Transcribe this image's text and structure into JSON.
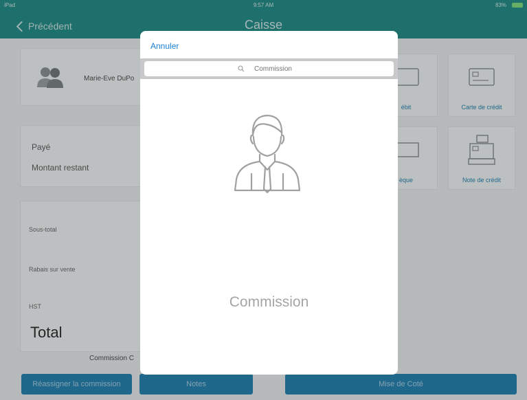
{
  "status_bar": {
    "carrier": "iPad",
    "time": "9:57 AM",
    "battery": "83%"
  },
  "nav": {
    "back_label": "Précédent",
    "title": "Caisse"
  },
  "client": {
    "name": "Marie-Eve DuPo"
  },
  "payment": {
    "paid_label": "Payé",
    "remaining_label": "Montant restant"
  },
  "totals": {
    "subtotal_label": "Sous-total",
    "discount_label": "Rabais sur vente",
    "tax_label": "HST",
    "total_label": "Total"
  },
  "commission_label": "Commission C",
  "tiles": [
    {
      "label": "ébit"
    },
    {
      "label": "Carte de crédit"
    },
    {
      "label": "èque"
    },
    {
      "label": "Note de crédit"
    }
  ],
  "buttons": {
    "reassign": "Réassigner la commission",
    "notes": "Notes",
    "set_aside": "Mise de Coté"
  },
  "modal": {
    "cancel_label": "Annuler",
    "search_placeholder": "Commission",
    "empty_label": "Commission"
  },
  "colors": {
    "header": "#1b8a86",
    "button": "#1c7fb0",
    "link": "#1a7fd6"
  }
}
